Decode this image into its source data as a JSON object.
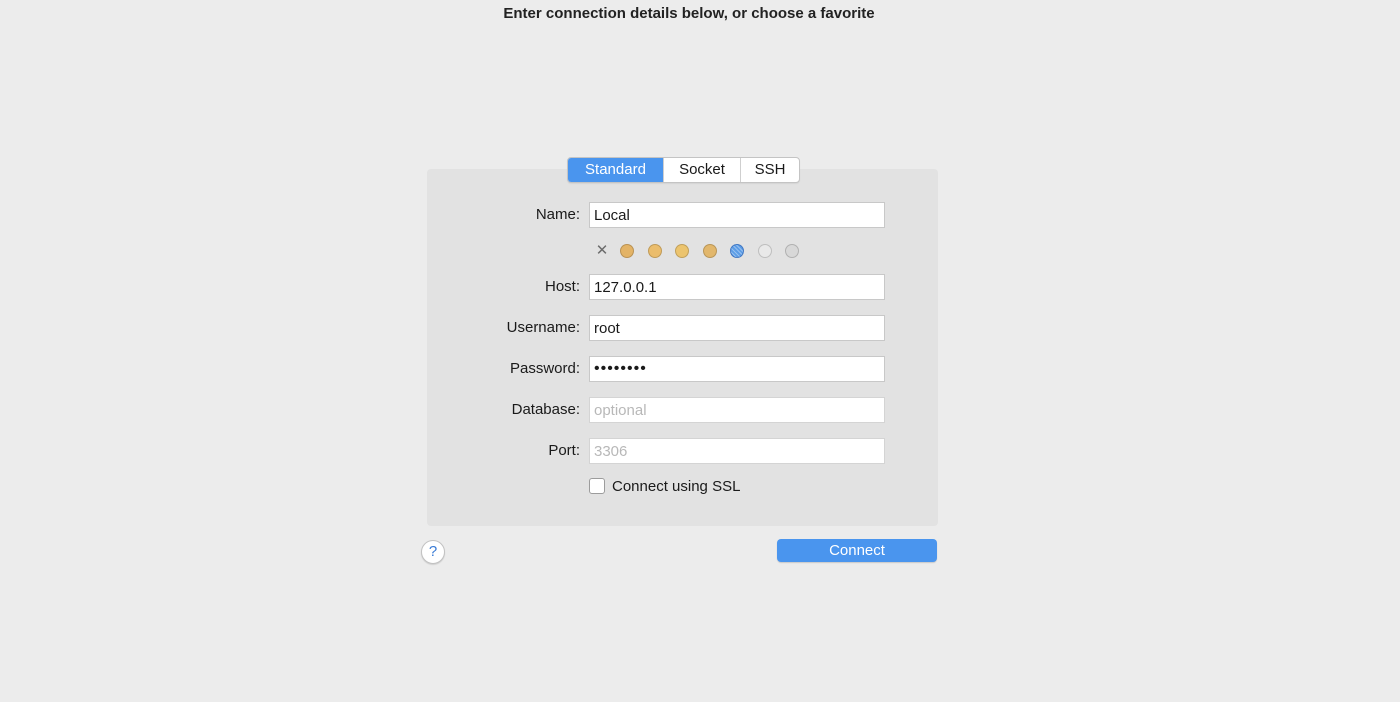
{
  "heading": "Enter connection details below, or choose a favorite",
  "tabs": [
    {
      "label": "Standard",
      "active": true
    },
    {
      "label": "Socket",
      "active": false
    },
    {
      "label": "SSH",
      "active": false
    }
  ],
  "form": {
    "name": {
      "label": "Name:",
      "value": "Local"
    },
    "host": {
      "label": "Host:",
      "value": "127.0.0.1"
    },
    "username": {
      "label": "Username:",
      "value": "root"
    },
    "password": {
      "label": "Password:",
      "value": "••••••••"
    },
    "database": {
      "label": "Database:",
      "value": "",
      "placeholder": "optional"
    },
    "port": {
      "label": "Port:",
      "value": "",
      "placeholder": "3306"
    }
  },
  "color_picker": {
    "clear_symbol": "✕",
    "swatches": [
      "#e3b366",
      "#ebbd6c",
      "#ecc46e",
      "#e2b76c",
      "#5c9de6",
      "#e9e9e9",
      "#d8d8d8"
    ],
    "selected_index": 4
  },
  "ssl": {
    "label": "Connect using SSL",
    "checked": false
  },
  "help": {
    "symbol": "?"
  },
  "connect_button": {
    "label": "Connect"
  }
}
